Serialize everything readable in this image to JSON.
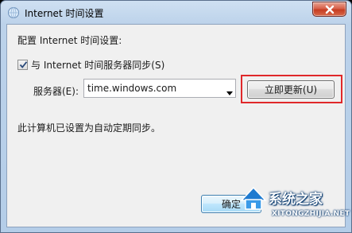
{
  "window": {
    "title": "Internet 时间设置",
    "app_icon": "globe-clock-icon",
    "close_icon": "close-icon"
  },
  "dialog": {
    "heading": "配置 Internet 时间设置:",
    "sync_checkbox": {
      "label": "与 Internet 时间服务器同步(S)",
      "checked": true
    },
    "server": {
      "label": "服务器(E):",
      "value": "time.windows.com"
    },
    "update_now_label": "立即更新(U)",
    "status_text": "此计算机已设置为自动定期同步。",
    "ok_label": "确定"
  },
  "watermark": {
    "brand": "系统之家",
    "url": "XITONGZHIJIA.NET"
  },
  "colors": {
    "highlight": "#e0282a",
    "close_button": "#c63d22",
    "title_gradient": "#bcd2ea"
  }
}
